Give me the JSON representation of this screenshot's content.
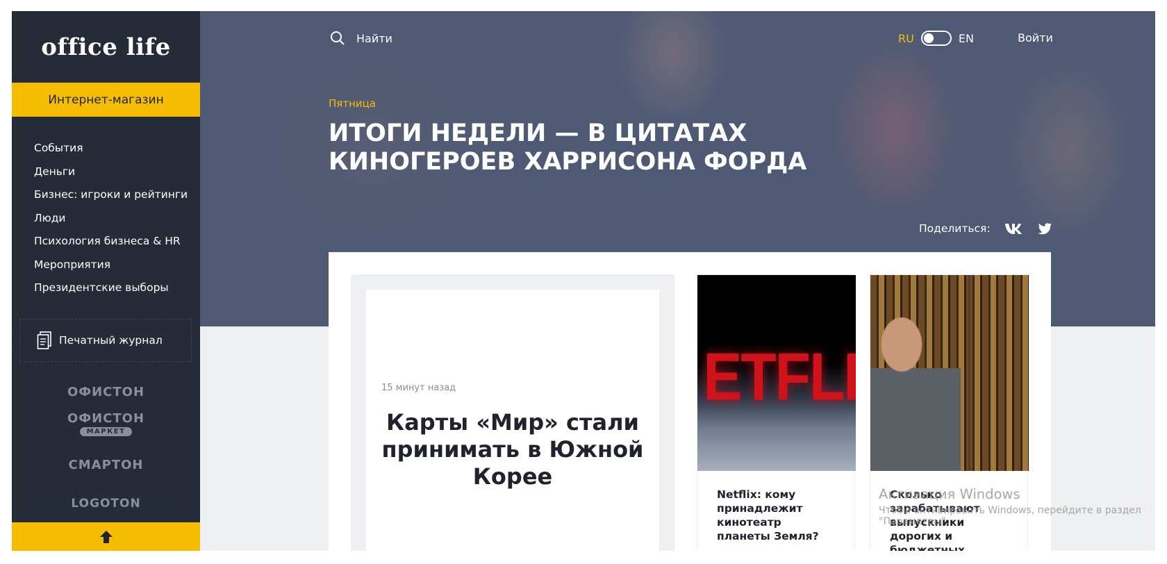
{
  "sidebar": {
    "logo": "office life",
    "shop_button": "Интернет-магазин",
    "nav_items": [
      "События",
      "Деньги",
      "Бизнес: игроки и рейтинги",
      "Люди",
      "Психология бизнеса & HR",
      "Мероприятия",
      "Президентские выборы"
    ],
    "print_magazine": "Печатный журнал",
    "partners": [
      {
        "name": "ОФИСТОН"
      },
      {
        "name": "ОФИСТОН",
        "sub": "МАРКЕТ"
      },
      {
        "name": "СМАРТОН"
      },
      {
        "name": "LOGOTON"
      }
    ],
    "up_icon": "arrow-up-icon"
  },
  "header": {
    "search_label": "Найти",
    "lang_ru": "RU",
    "lang_en": "EN",
    "login": "Войти"
  },
  "hero": {
    "category": "Пятница",
    "title": "Итоги недели — в цитатах киногероев Харрисона Форда",
    "share_label": "Поделиться:",
    "share_icons": [
      "vk-icon",
      "twitter-icon"
    ]
  },
  "cards": {
    "main": {
      "time": "15 минут назад",
      "title": "Карты «Мир» стали принимать в Южной Корее"
    },
    "small": [
      {
        "title": "Netflix: кому принадлежит кинотеатр планеты Земля?",
        "image_text": "ETFLI"
      },
      {
        "title": "Сколько зарабатывают выпускники дорогих и бюджетных специальностей"
      }
    ]
  },
  "overlay": {
    "activation_title": "Активация Windows",
    "activation_text": "Чтобы активировать Windows, перейдите в раздел \"Параметры\"."
  },
  "colors": {
    "accent": "#f5bc00",
    "sidebar_bg": "#262b38",
    "netflix_red": "#d0121b"
  }
}
